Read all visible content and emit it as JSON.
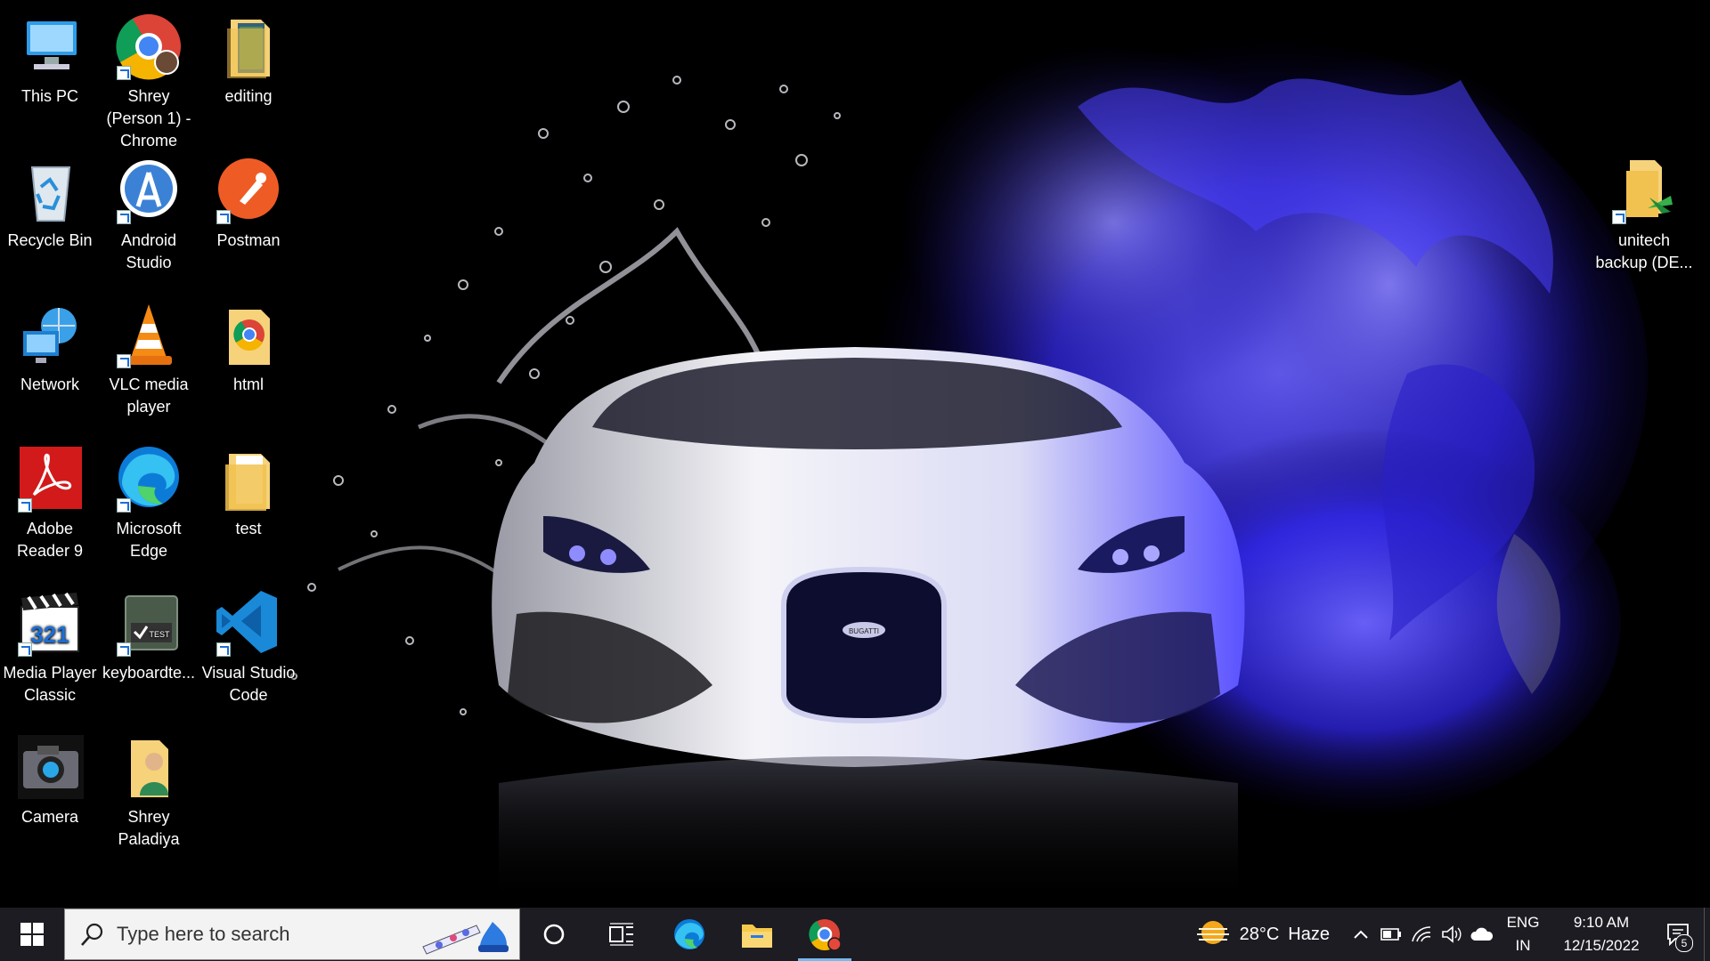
{
  "desktop": {
    "icons": [
      {
        "id": "this-pc",
        "label": "This PC"
      },
      {
        "id": "chrome-shrey",
        "label": "Shrey (Person 1) - Chrome"
      },
      {
        "id": "editing",
        "label": "editing"
      },
      {
        "id": "recycle-bin",
        "label": "Recycle Bin"
      },
      {
        "id": "android-studio",
        "label": "Android Studio"
      },
      {
        "id": "postman",
        "label": "Postman"
      },
      {
        "id": "network",
        "label": "Network"
      },
      {
        "id": "vlc",
        "label": "VLC media player"
      },
      {
        "id": "html",
        "label": "html"
      },
      {
        "id": "adobe-reader",
        "label": "Adobe Reader 9"
      },
      {
        "id": "edge",
        "label": "Microsoft Edge"
      },
      {
        "id": "test",
        "label": "test"
      },
      {
        "id": "mpc",
        "label": "Media Player Classic"
      },
      {
        "id": "keyboardtest",
        "label": "keyboardte..."
      },
      {
        "id": "vscode",
        "label": "Visual Studio Code"
      },
      {
        "id": "camera",
        "label": "Camera"
      },
      {
        "id": "shrey-paladiya",
        "label": "Shrey Paladiya"
      },
      {
        "id": "unitech-backup",
        "label": "unitech backup (DE..."
      }
    ]
  },
  "wallpaper": {
    "emblem": "BUGATTI",
    "colors": {
      "flame": "#3d35ff",
      "car": "#e8e8f0",
      "background": "#000000"
    }
  },
  "taskbar": {
    "search_placeholder": "Type here to search",
    "pinned": [
      "cortana-icon",
      "task-view-icon",
      "edge-icon",
      "file-explorer-icon",
      "chrome-icon"
    ],
    "active_app": "chrome",
    "weather": {
      "temp": "28°C",
      "condition": "Haze"
    },
    "language": {
      "line1": "ENG",
      "line2": "IN"
    },
    "clock": {
      "time": "9:10 AM",
      "date": "12/15/2022"
    },
    "notifications_count": "5"
  }
}
